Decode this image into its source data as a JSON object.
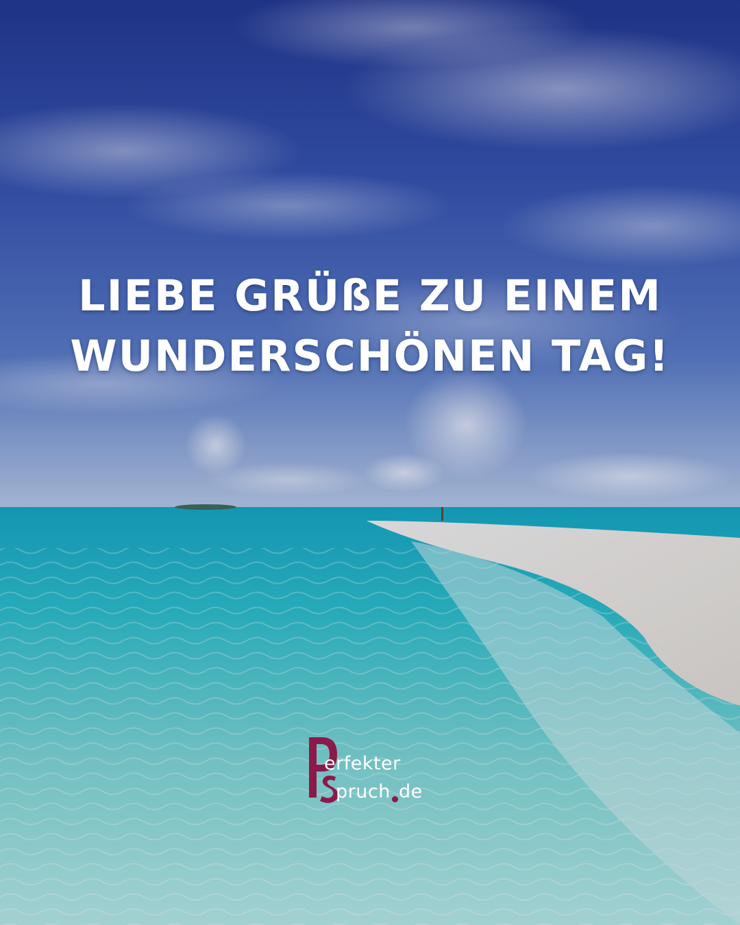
{
  "quote": {
    "line1": "LIEBE GRÜßE ZU EINEM",
    "line2": "WUNDERSCHÖNEN TAG!"
  },
  "logo": {
    "alt": "Perfekter Spruch .de",
    "part_perfekter": "erfekter",
    "part_spruch": "pruch",
    "part_domain": "de",
    "brand_color": "#8b1a4a"
  },
  "colors": {
    "sky_top": "#2a3f9a",
    "sky_mid": "#4f6fbe",
    "horizon": "#c8d8ee",
    "water_deep": "#1fb3c4",
    "water_light": "#8fe0dc",
    "sand": "#eeeae2"
  }
}
